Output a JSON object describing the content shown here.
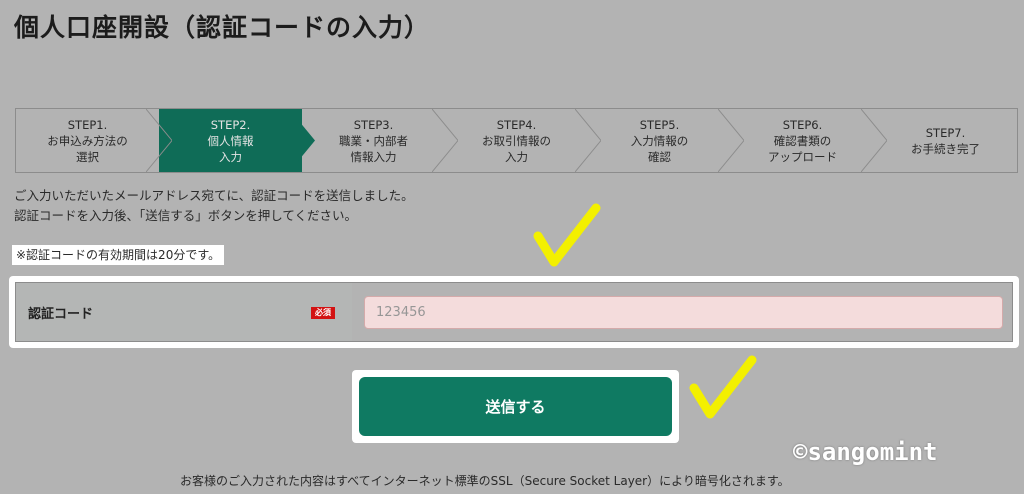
{
  "page": {
    "title": "個人口座開設（認証コードの入力）"
  },
  "steps": [
    {
      "label": "STEP1.\nお申込み方法の\n選択",
      "active": false
    },
    {
      "label": "STEP2.\n個人情報\n入力",
      "active": true
    },
    {
      "label": "STEP3.\n職業・内部者\n情報入力",
      "active": false
    },
    {
      "label": "STEP4.\nお取引情報の\n入力",
      "active": false
    },
    {
      "label": "STEP5.\n入力情報の\n確認",
      "active": false
    },
    {
      "label": "STEP6.\n確認書類の\nアップロード",
      "active": false
    },
    {
      "label": "STEP7.\nお手続き完了",
      "active": false
    }
  ],
  "message": {
    "line1": "ご入力いただいたメールアドレス宛てに、認証コードを送信しました。",
    "line2": "認証コードを入力後、「送信する」ボタンを押してください。"
  },
  "note": "※認証コードの有効期間は20分です。",
  "form": {
    "label": "認証コード",
    "required_badge": "必須",
    "placeholder": "123456"
  },
  "submit": {
    "label": "送信する"
  },
  "footer": "お客様のご入力された内容はすべてインターネット標準のSSL（Secure Socket Layer）により暗号化されます。",
  "watermark": "©sangomint",
  "colors": {
    "active_step": "#0f6c57",
    "button": "#0f7a62",
    "required": "#d31212",
    "check_annotation": "#f3f000"
  },
  "icons": [
    "check-mark-icon",
    "check-mark-icon"
  ]
}
